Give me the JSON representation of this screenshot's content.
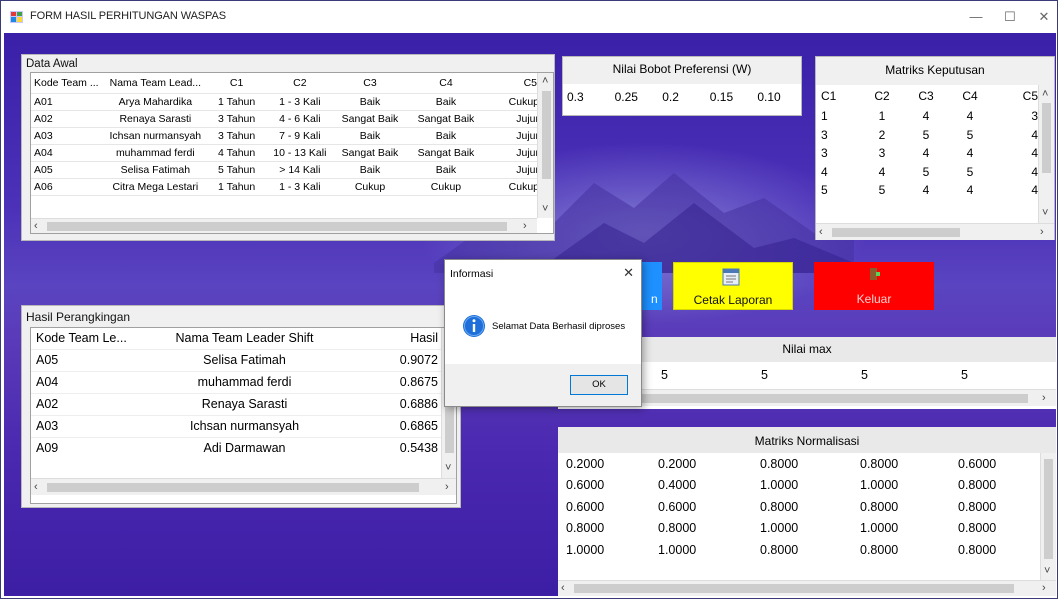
{
  "window": {
    "title": "FORM HASIL PERHITUNGAN WASPAS",
    "min_icon": "minimize-icon",
    "max_icon": "maximize-icon",
    "close_icon": "close-icon"
  },
  "data_awal": {
    "title": "Data Awal",
    "columns": [
      "Kode Team ...",
      "Nama Team Lead...",
      "C1",
      "C2",
      "C3",
      "C4",
      "C5"
    ],
    "rows": [
      [
        "A01",
        "Arya Mahardika",
        "1 Tahun",
        "1 - 3 Kali",
        "Baik",
        "Baik",
        "Cukup"
      ],
      [
        "A02",
        "Renaya Sarasti",
        "3 Tahun",
        "4 - 6 Kali",
        "Sangat Baik",
        "Sangat Baik",
        "Jujur"
      ],
      [
        "A03",
        "Ichsan nurmansyah",
        "3 Tahun",
        "7 - 9 Kali",
        "Baik",
        "Baik",
        "Jujur"
      ],
      [
        "A04",
        "muhammad ferdi",
        "4 Tahun",
        "10 - 13 Kali",
        "Sangat Baik",
        "Sangat Baik",
        "Jujur"
      ],
      [
        "A05",
        "Selisa Fatimah",
        "5 Tahun",
        "> 14 Kali",
        "Baik",
        "Baik",
        "Jujur"
      ],
      [
        "A06",
        "Citra Mega Lestari",
        "1 Tahun",
        "1 - 3 Kali",
        "Cukup",
        "Cukup",
        "Cukup"
      ]
    ]
  },
  "bobot": {
    "title": "Nilai Bobot Preferensi (W)",
    "values": [
      "0.3",
      "0.25",
      "0.2",
      "0.15",
      "0.10"
    ]
  },
  "matriks_keputusan": {
    "title": "Matriks Keputusan",
    "columns": [
      "C1",
      "C2",
      "C3",
      "C4",
      "C5"
    ],
    "rows": [
      [
        "1",
        "1",
        "4",
        "4",
        "3"
      ],
      [
        "3",
        "2",
        "5",
        "5",
        "4"
      ],
      [
        "3",
        "3",
        "4",
        "4",
        "4"
      ],
      [
        "4",
        "4",
        "5",
        "5",
        "4"
      ],
      [
        "5",
        "5",
        "4",
        "4",
        "4"
      ]
    ]
  },
  "buttons": {
    "proses_label": "n",
    "cetak_label": "Cetak Laporan",
    "keluar_label": "Keluar",
    "cetak_color": "#ffff00",
    "keluar_color": "#ff0000",
    "proses_color": "#1e90ff"
  },
  "hasil": {
    "title": "Hasil Perangkingan",
    "columns": [
      "Kode Team Le...",
      "Nama Team Leader Shift",
      "Hasil"
    ],
    "rows": [
      [
        "A05",
        "Selisa Fatimah",
        "0.9072"
      ],
      [
        "A04",
        "muhammad ferdi",
        "0.8675"
      ],
      [
        "A02",
        "Renaya Sarasti",
        "0.6886"
      ],
      [
        "A03",
        "Ichsan nurmansyah",
        "0.6865"
      ],
      [
        "A09",
        "Adi Darmawan",
        "0.5438"
      ]
    ]
  },
  "nilai_max": {
    "title": "Nilai max",
    "values": [
      "5",
      "5",
      "5",
      "5"
    ]
  },
  "matriks_normalisasi": {
    "title": "Matriks Normalisasi",
    "rows": [
      [
        "0.2000",
        "0.2000",
        "0.8000",
        "0.8000",
        "0.6000"
      ],
      [
        "0.6000",
        "0.4000",
        "1.0000",
        "1.0000",
        "0.8000"
      ],
      [
        "0.6000",
        "0.6000",
        "0.8000",
        "0.8000",
        "0.8000"
      ],
      [
        "0.8000",
        "0.8000",
        "1.0000",
        "1.0000",
        "0.8000"
      ],
      [
        "1.0000",
        "1.0000",
        "0.8000",
        "0.8000",
        "0.8000"
      ]
    ]
  },
  "dialog": {
    "title": "Informasi",
    "message": "Selamat Data Berhasil diproses",
    "ok_label": "OK",
    "icon": "information-icon"
  }
}
